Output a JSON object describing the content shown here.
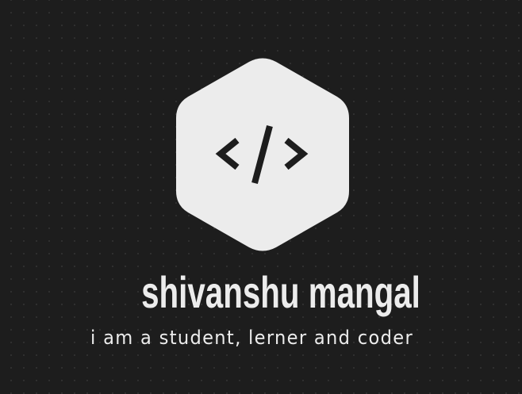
{
  "theme": {
    "background": "#1d1d1d",
    "foreground": "#ececec",
    "icon_color": "#1d1d1d"
  },
  "logo": {
    "shape": "hexagon",
    "icon": "code-slash-icon"
  },
  "name": "shivanshu mangal",
  "tagline": "i am a student, lerner and coder"
}
